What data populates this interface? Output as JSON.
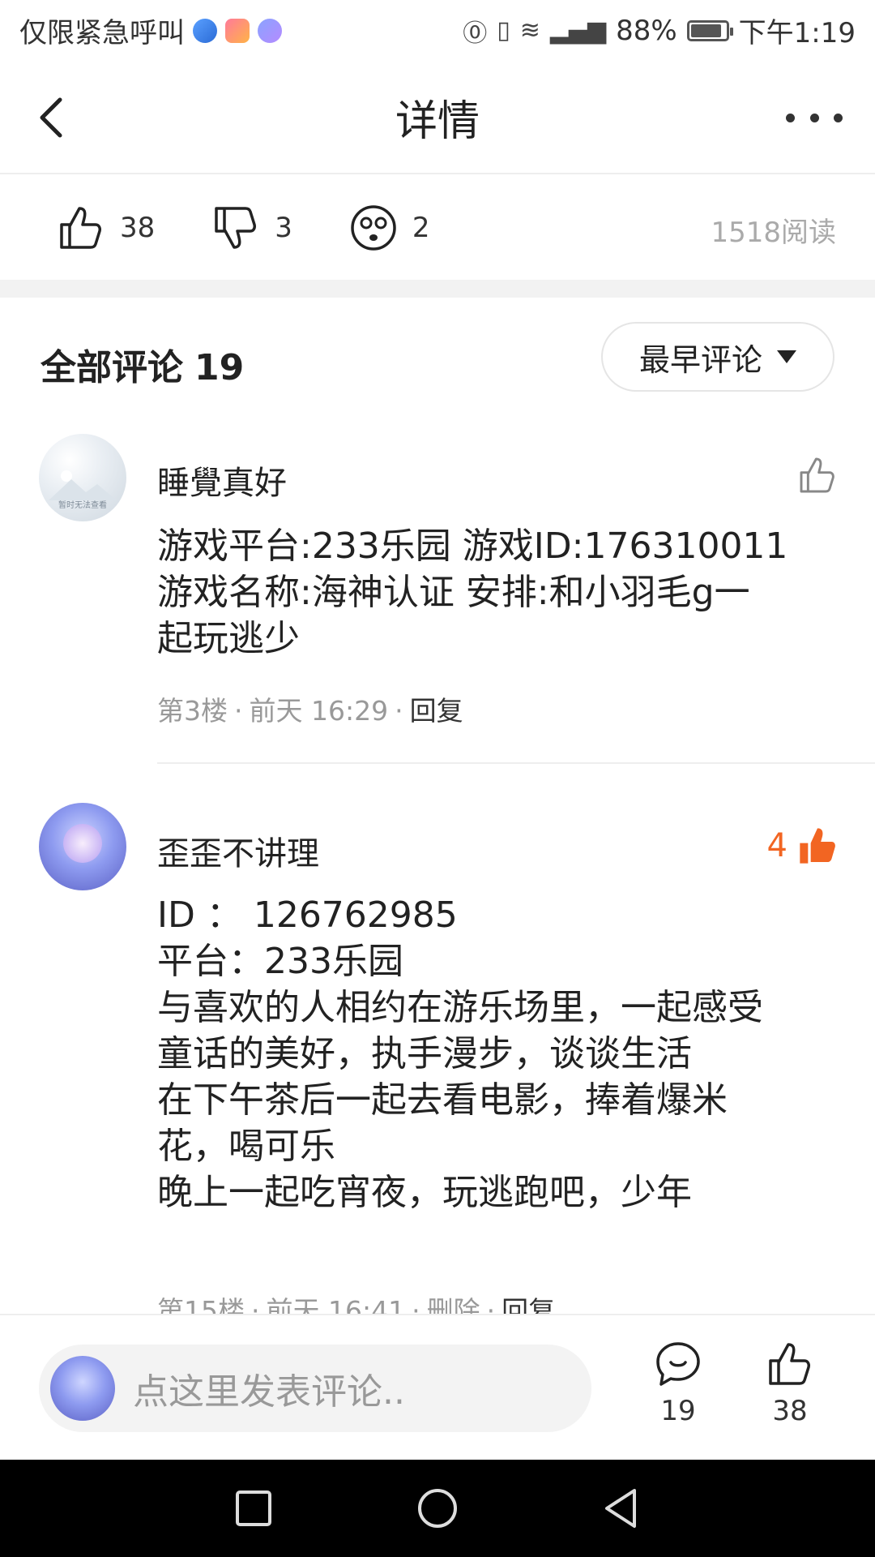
{
  "status_bar": {
    "carrier_text": "仅限紧急呼叫",
    "battery_percent": "88%",
    "battery_level": 0.88,
    "time": "下午1:19"
  },
  "header": {
    "title": "详情"
  },
  "reactions": {
    "like_count": "38",
    "dislike_count": "3",
    "dizzy_count": "2",
    "reads": "1518阅读"
  },
  "comments_section": {
    "title": "全部评论",
    "count": "19",
    "sort_label": "最早评论"
  },
  "comments": [
    {
      "name": "睡覺真好",
      "avatar_caption": "暂时无法查看",
      "like_count": "",
      "lines": [
        "游戏平台:233乐园  游戏ID:176310011",
        "游戏名称:海神认证   安排:和小羽毛g一",
        "起玩逃少"
      ],
      "floor": "第3楼",
      "time": "前天 16:29",
      "reply": "回复"
    },
    {
      "name": "歪歪不讲理",
      "like_count": "4",
      "lines": [
        "ID ： 126762985",
        "平台：233乐园",
        "与喜欢的人相约在游乐场里，一起感受",
        "童话的美好，执手漫步，谈谈生活",
        "在下午茶后一起去看电影，捧着爆米",
        "花，喝可乐",
        "晚上一起吃宵夜，玩逃跑吧，少年"
      ],
      "floor": "第15楼",
      "time": "前天 16:41",
      "delete": "删除",
      "reply": "回复"
    }
  ],
  "bottom_bar": {
    "placeholder": "点这里发表评论..",
    "comment_count": "19",
    "like_count": "38"
  },
  "colors": {
    "accent_orange": "#f26522",
    "muted_text": "#999999"
  }
}
